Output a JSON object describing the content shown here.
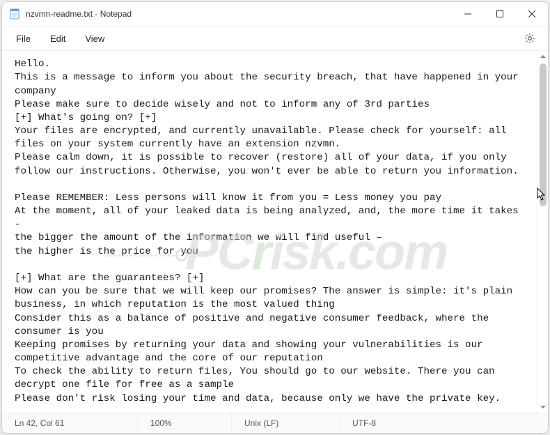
{
  "titlebar": {
    "title": "nzvmn-readme.txt - Notepad"
  },
  "menu": {
    "file": "File",
    "edit": "Edit",
    "view": "View"
  },
  "editor": {
    "content": "Hello.\nThis is a message to inform you about the security breach, that have happened in your company\nPlease make sure to decide wisely and not to inform any of 3rd parties\n[+] What's going on? [+]\nYour files are encrypted, and currently unavailable. Please check for yourself: all files on your system currently have an extension nzvmn.\nPlease calm down, it is possible to recover (restore) all of your data, if you only follow our instructions. Otherwise, you won't ever be able to return you information.\n\nPlease REMEMBER: Less persons will know it from you = Less money you pay\nAt the moment, all of your leaked data is being analyzed, and, the more time it takes -\nthe bigger the amount of the information we will find useful –\nthe higher is the price for you\n\n[+] What are the guarantees? [+]\nHow can you be sure that we will keep our promises? The answer is simple: it's plain business, in which reputation is the most valued thing\nConsider this as a balance of positive and negative consumer feedback, where the consumer is you\nKeeping promises by returning your data and showing your vulnerabilities is our competitive advantage and the core of our reputation\nTo check the ability to return files, You should go to our website. There you can decrypt one file for free as a sample\nPlease don't risk losing your time and data, because only we have the private key."
  },
  "status": {
    "position": "Ln 42, Col 61",
    "zoom": "100%",
    "line_ending": "Unix (LF)",
    "encoding": "UTF-8"
  },
  "watermark": {
    "text": "PCrisk.com"
  }
}
